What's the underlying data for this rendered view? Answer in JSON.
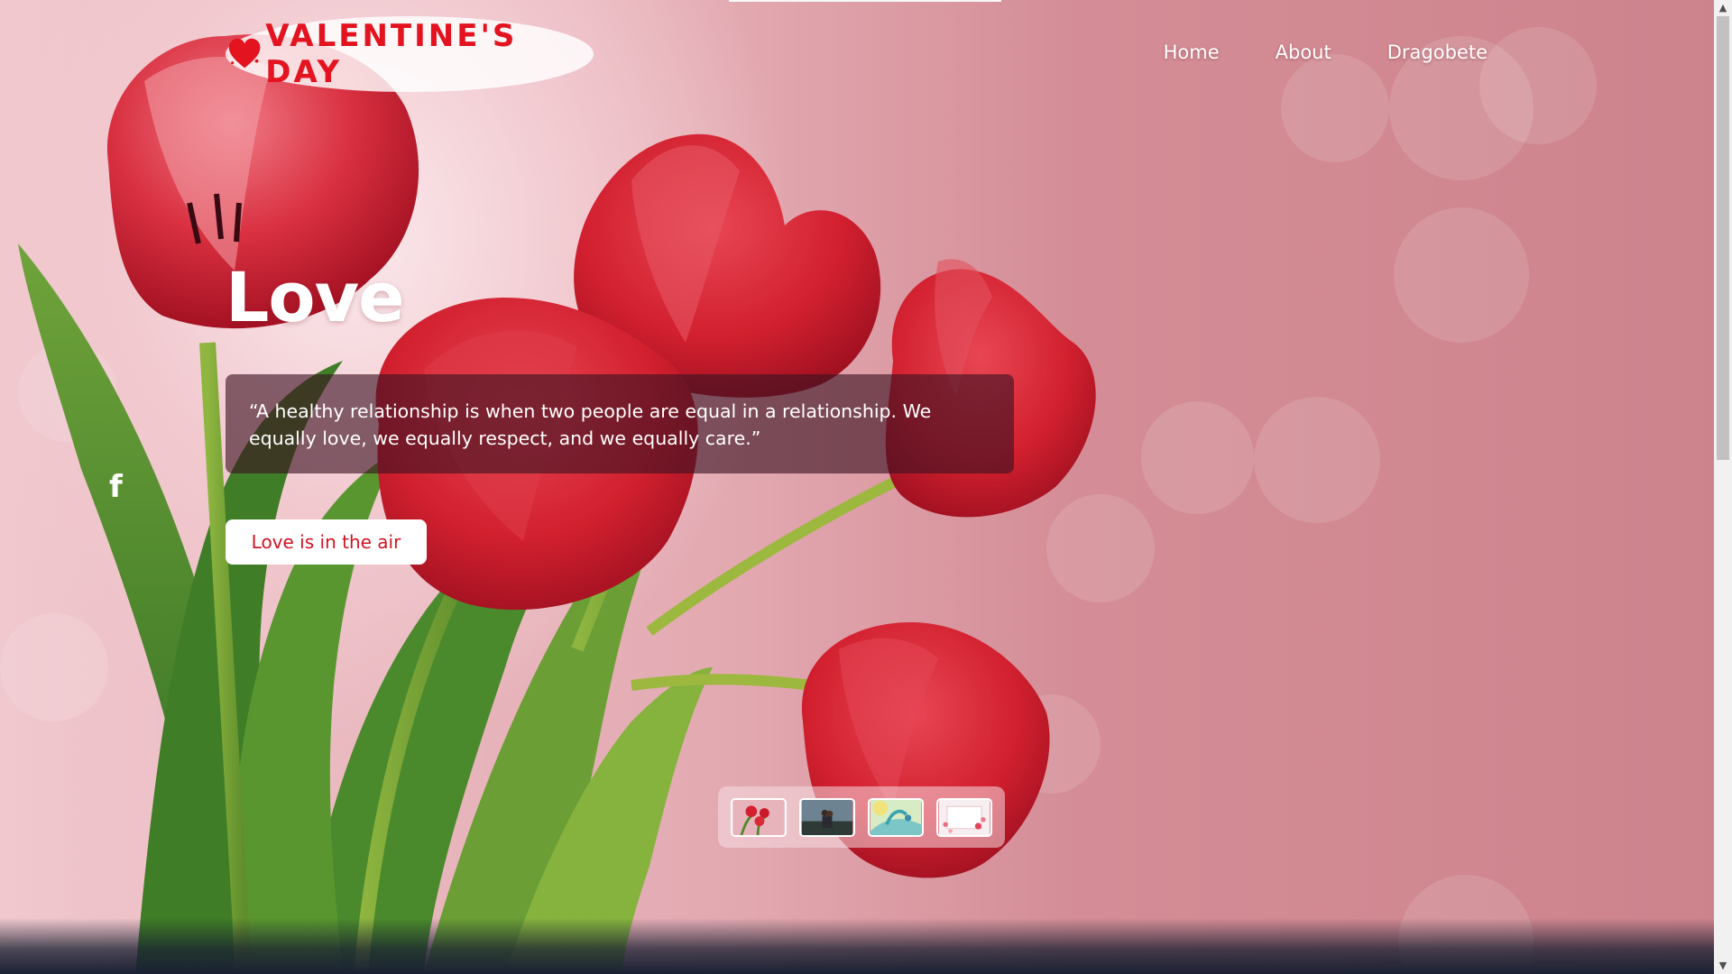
{
  "header": {
    "logo_text": "VALENTINE'S DAY",
    "nav": [
      "Home",
      "About",
      "Dragobete"
    ]
  },
  "hero": {
    "title": "Love",
    "quote": "“A healthy relationship is when two people are equal in a relationship. We equally love, we equally respect, and we equally care.”",
    "cta_label": "Love is in the air"
  },
  "social": {
    "facebook_glyph": "f"
  },
  "thumbnails": [
    "tulips",
    "couple",
    "birds",
    "hearts-card"
  ],
  "colors": {
    "accent_red": "#e3131f",
    "button_text": "#d11423",
    "quote_bg": "#3c1222"
  }
}
